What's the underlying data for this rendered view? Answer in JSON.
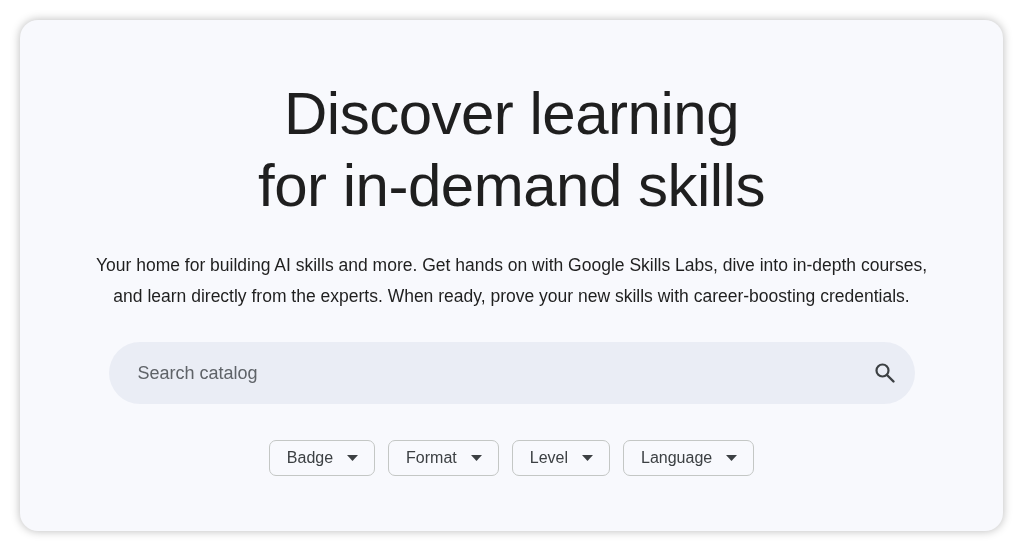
{
  "heading": {
    "lines": [
      "Discover learning",
      "for in-demand skills"
    ]
  },
  "description": [
    "Your home for building AI skills and more. Get hands on with Google Skills Labs, dive into in-depth courses,",
    "and learn directly from the experts. When ready, prove your new skills with career-boosting credentials."
  ],
  "search": {
    "placeholder": "Search catalog"
  },
  "filters": [
    {
      "label": "Badge"
    },
    {
      "label": "Format"
    },
    {
      "label": "Level"
    },
    {
      "label": "Language"
    }
  ]
}
